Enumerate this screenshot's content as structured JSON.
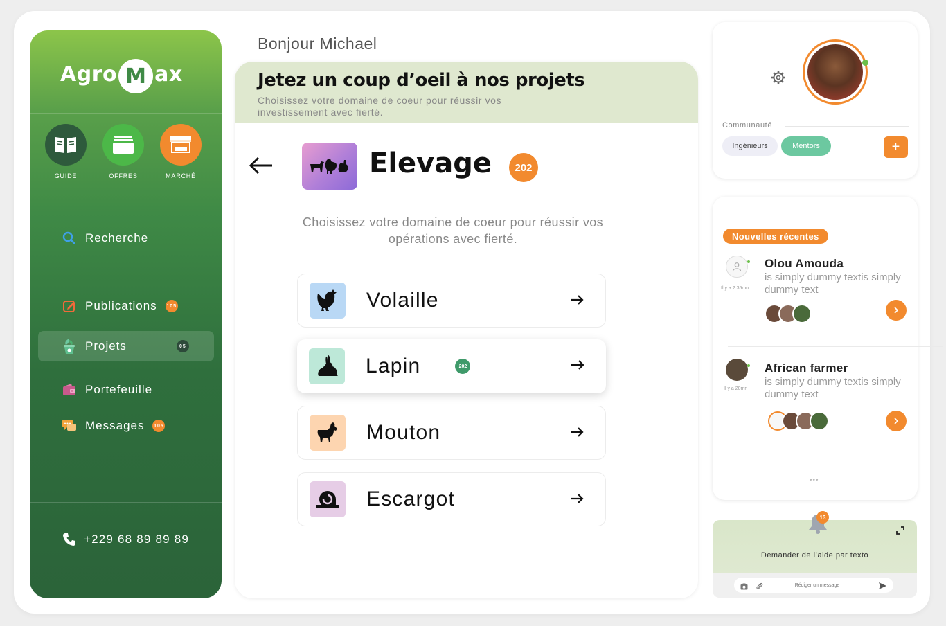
{
  "brand": {
    "logo_left": "Agro",
    "logo_mid": "M",
    "logo_right": "ax"
  },
  "colors": {
    "accent_orange": "#f28a2e",
    "green_dark": "#2f6f3d",
    "green_light": "#8cc54a",
    "mint": "#6cc8a0"
  },
  "sidebar": {
    "quick_actions": [
      {
        "label": "GUIDE",
        "icon": "book-icon"
      },
      {
        "label": "OFFRES",
        "icon": "box-icon"
      },
      {
        "label": "MARCHÉ",
        "icon": "market-icon"
      }
    ],
    "search_label": "Recherche",
    "items": [
      {
        "label": "Publications",
        "badge": "105",
        "icon": "edit-icon"
      },
      {
        "label": "Projets",
        "badge": "05",
        "icon": "plant-icon"
      },
      {
        "label": "Portefeuille",
        "badge": "",
        "icon": "wallet-icon"
      },
      {
        "label": "Messages",
        "badge": "105",
        "icon": "chat-icon"
      }
    ],
    "phone": "+229 68 89 89 89"
  },
  "main": {
    "greeting": "Bonjour Michael",
    "banner_title": "Jetez un coup d’oeil à nos projets",
    "banner_sub": "Choisissez votre domaine  de coeur pour réussir vos investissement avec fierté.",
    "category_title": "Elevage",
    "category_count": "202",
    "category_desc": "Choisissez votre domaine  de coeur pour réussir vos opérations avec fierté.",
    "subcategories": [
      {
        "label": "Volaille",
        "icon": "chicken-icon",
        "badge": ""
      },
      {
        "label": "Lapin",
        "icon": "rabbit-icon",
        "badge": "202"
      },
      {
        "label": "Mouton",
        "icon": "goat-icon",
        "badge": ""
      },
      {
        "label": "Escargot",
        "icon": "snail-icon",
        "badge": ""
      }
    ]
  },
  "profile": {
    "community_label": "Communauté",
    "chips": [
      "Ingénieurs",
      "Mentors"
    ],
    "add_label": "+"
  },
  "news": {
    "tag": "Nouvelles récentes",
    "items": [
      {
        "name": "Olou Amouda",
        "time": "Il y a 2:35mn",
        "text": "is simply dummy textis simply dummy text"
      },
      {
        "name": "African farmer",
        "time": "Il y a 20mn",
        "text": "is simply dummy textis simply dummy text"
      }
    ],
    "more": "•••"
  },
  "help": {
    "notif_count": "13",
    "text": "Demander de l’aide par texto",
    "placeholder": "Rédiger un message"
  }
}
